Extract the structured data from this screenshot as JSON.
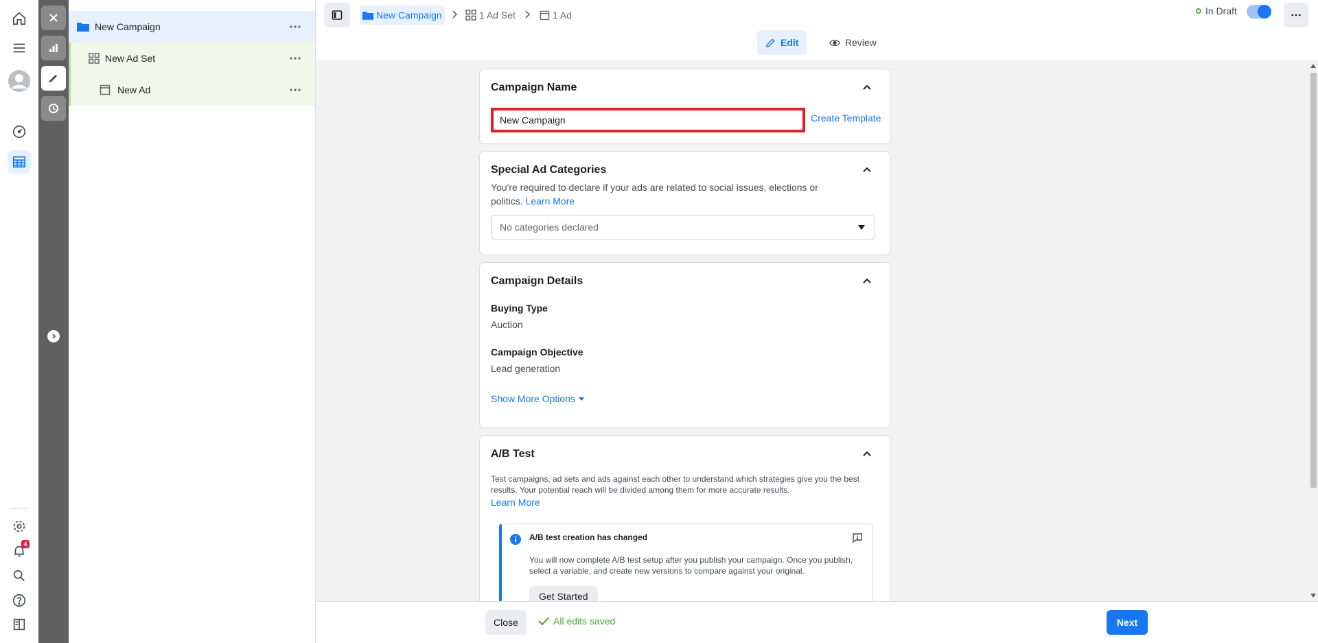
{
  "global_nav": {
    "notification_count": "4",
    "icons": [
      "home-icon",
      "menu-icon",
      "avatar",
      "performance-gauge-icon",
      "ads-manager-table-icon",
      "settings-icon",
      "notifications-icon",
      "search-icon",
      "help-icon",
      "feedback-panel-icon"
    ]
  },
  "tree": {
    "campaign": "New Campaign",
    "ad_set": "New Ad Set",
    "ad": "New Ad"
  },
  "breadcrumb": {
    "campaign": "New Campaign",
    "ad_set": "1 Ad Set",
    "ad": "1 Ad"
  },
  "status": {
    "draft": "In Draft"
  },
  "modes": {
    "edit": "Edit",
    "review": "Review"
  },
  "campaign_name": {
    "title": "Campaign Name",
    "value": "New Campaign",
    "create_template": "Create Template"
  },
  "special_ad": {
    "title": "Special Ad Categories",
    "description": "You're required to declare if your ads are related to social issues, elections or politics.",
    "learn_more": "Learn More",
    "select_value": "No categories declared"
  },
  "campaign_details": {
    "title": "Campaign Details",
    "buying_type_label": "Buying Type",
    "buying_type_value": "Auction",
    "objective_label": "Campaign Objective",
    "objective_value": "Lead generation",
    "show_more": "Show More Options"
  },
  "ab_test": {
    "title": "A/B Test",
    "description": "Test campaigns, ad sets and ads against each other to understand which strategies give you the best results. Your potential reach will be divided among them for more accurate results.",
    "learn_more": "Learn More",
    "notice_title": "A/B test creation has changed",
    "notice_body": "You will now complete A/B test setup after you publish your campaign. Once you publish, select a variable, and create new versions to compare against your original.",
    "get_started": "Get Started"
  },
  "footer": {
    "close": "Close",
    "saved": "All edits saved",
    "next": "Next"
  },
  "colors": {
    "accent": "#1877f2",
    "highlight_border": "#e41e25",
    "saved_green": "#42a72a",
    "tool_strip": "#606060"
  }
}
